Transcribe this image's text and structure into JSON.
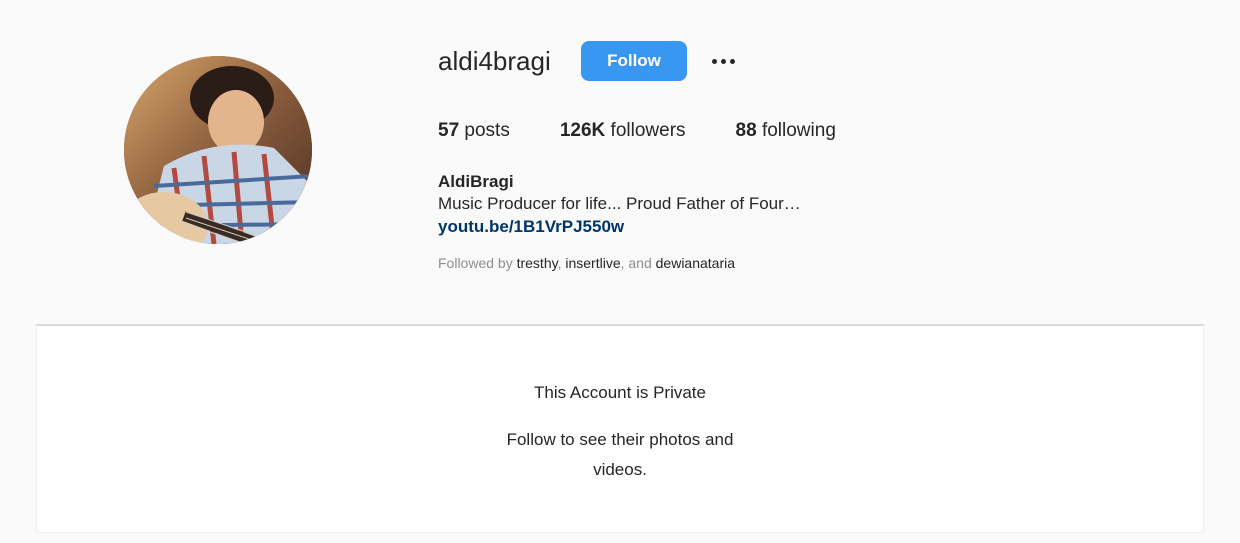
{
  "profile": {
    "username": "aldi4bragi",
    "follow_label": "Follow",
    "more_icon": "more-options-icon",
    "avatar_icon": "profile-avatar",
    "stats": {
      "posts_count": "57",
      "posts_label": "posts",
      "followers_count": "126K",
      "followers_label": "followers",
      "following_count": "88",
      "following_label": "following"
    },
    "full_name": "AldiBragi",
    "bio": "Music Producer for life... Proud Father of Four…",
    "link": "youtu.be/1B1VrPJ550w",
    "followed_by": {
      "prefix": "Followed by",
      "accounts": [
        "tresthy",
        "insertlive",
        "dewianataria"
      ],
      "separator": ",",
      "conjunction": ", and"
    }
  },
  "private_notice": {
    "title": "This Account is Private",
    "message": "Follow to see their photos and videos."
  },
  "colors": {
    "background": "#fafafa",
    "follow_button": "#3897f0",
    "link": "#003569",
    "muted_text": "#8e8e8e",
    "text": "#262626"
  }
}
